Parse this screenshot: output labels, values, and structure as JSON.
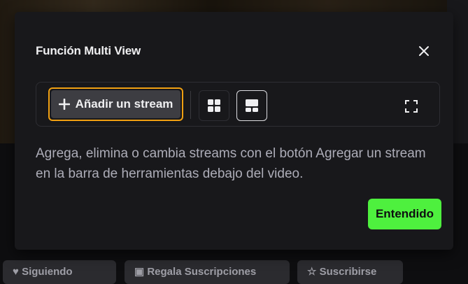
{
  "dialog": {
    "title": "Función Multi View",
    "add_stream_label": "Añadir un stream",
    "description": "Agrega, elimina o cambia streams con el botón Agregar un stream en la barra de herramientas debajo del video.",
    "confirm_label": "Entendido"
  },
  "background": {
    "buttons": [
      "Siguiendo",
      "Regala Suscripciones",
      "Suscribirse"
    ]
  },
  "colors": {
    "accent_green": "#4ef03e",
    "focus_outline": "#f0a012",
    "dialog_bg": "#18181b"
  },
  "icons": [
    "close-icon",
    "plus-icon",
    "grid-layout-icon",
    "focus-layout-icon",
    "fullscreen-icon",
    "heart-icon",
    "gift-icon",
    "star-icon"
  ]
}
